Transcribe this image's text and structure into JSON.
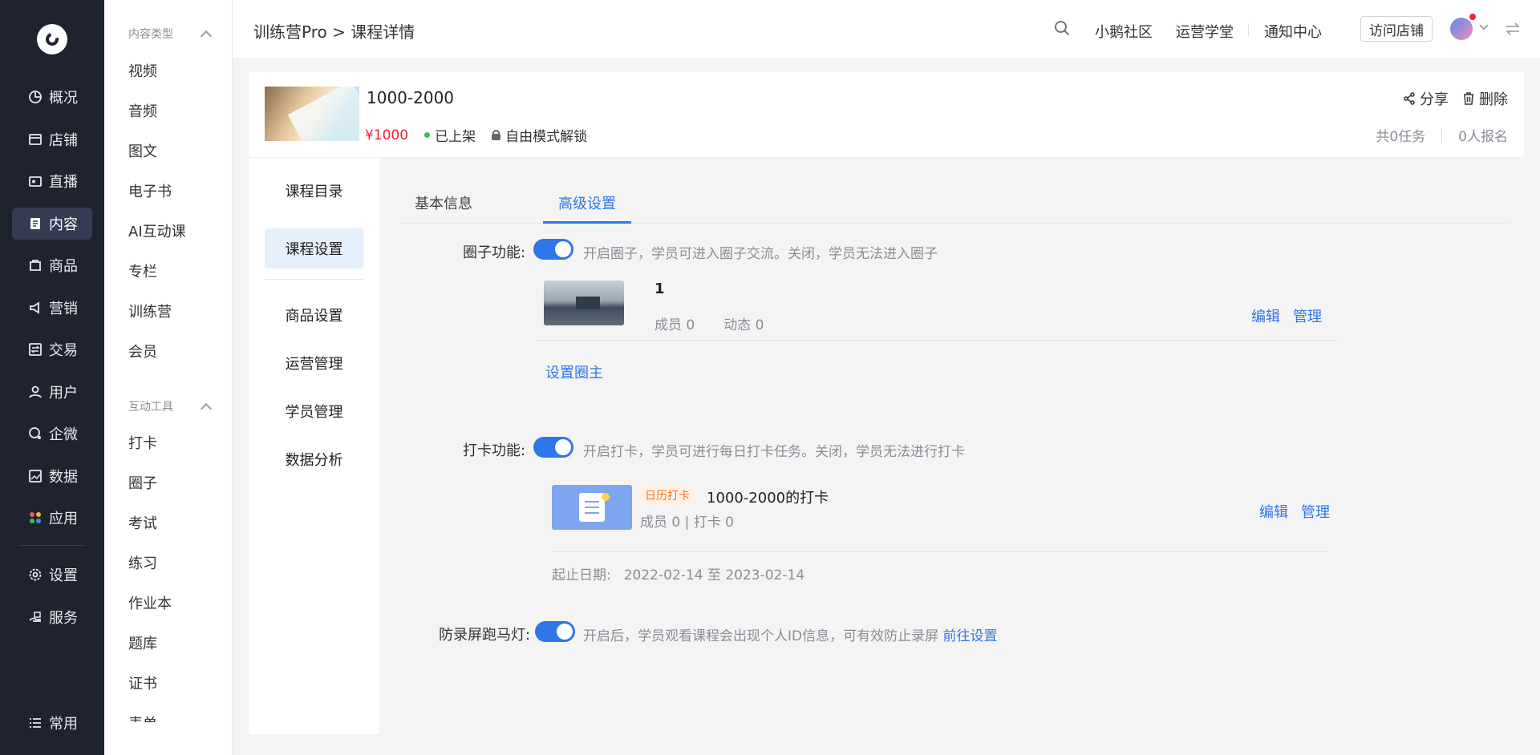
{
  "nav": {
    "items": [
      {
        "label": "概况",
        "icon": "pie-chart-icon"
      },
      {
        "label": "店铺",
        "icon": "store-icon"
      },
      {
        "label": "直播",
        "icon": "live-icon"
      },
      {
        "label": "内容",
        "icon": "content-icon"
      },
      {
        "label": "商品",
        "icon": "goods-icon"
      },
      {
        "label": "营销",
        "icon": "megaphone-icon"
      },
      {
        "label": "交易",
        "icon": "trade-icon"
      },
      {
        "label": "用户",
        "icon": "user-icon"
      },
      {
        "label": "企微",
        "icon": "wecom-icon"
      },
      {
        "label": "数据",
        "icon": "data-icon"
      },
      {
        "label": "应用",
        "icon": "apps-icon"
      },
      {
        "label": "设置",
        "icon": "gear-icon"
      },
      {
        "label": "服务",
        "icon": "service-icon"
      },
      {
        "label": "常用",
        "icon": "list-icon"
      }
    ],
    "active": "内容"
  },
  "side2": {
    "group1": "内容类型",
    "group1_items": [
      "视频",
      "音频",
      "图文",
      "电子书",
      "AI互动课",
      "专栏",
      "训练营",
      "会员"
    ],
    "group2": "互动工具",
    "group2_items": [
      "打卡",
      "圈子",
      "考试",
      "练习",
      "作业本",
      "题库",
      "证书",
      "表单"
    ]
  },
  "topbar": {
    "breadcrumb": "训练营Pro > 课程详情",
    "links": [
      "小鹅社区",
      "运营学堂",
      "通知中心"
    ],
    "visit_button": "访问店铺"
  },
  "course": {
    "title": "1000-2000",
    "price": "¥1000",
    "status": "已上架",
    "unlock_mode": "自由模式解锁",
    "share": "分享",
    "delete": "删除",
    "tasks": "共0任务",
    "signups": "0人报名"
  },
  "content_side": {
    "items": [
      "课程目录",
      "课程设置",
      "商品设置",
      "运营管理",
      "学员管理",
      "数据分析"
    ],
    "active": "课程设置"
  },
  "tabs": {
    "items": [
      "基本信息",
      "高级设置"
    ],
    "active": "高级设置"
  },
  "circle": {
    "label": "圈子功能:",
    "enabled": true,
    "desc": "开启圈子，学员可进入圈子交流。关闭，学员无法进入圈子",
    "item_title": "1",
    "members": "成员 0",
    "posts": "动态 0",
    "edit": "编辑",
    "manage": "管理",
    "set_owner": "设置圈主"
  },
  "checkin": {
    "label": "打卡功能:",
    "enabled": true,
    "desc": "开启打卡，学员可进行每日打卡任务。关闭，学员无法进行打卡",
    "tag": "日历打卡",
    "item_title": "1000-2000的打卡",
    "meta": "成员 0 | 打卡 0",
    "edit": "编辑",
    "manage": "管理",
    "date_label": "起止日期:",
    "date_range": "2022-02-14 至 2023-02-14"
  },
  "marquee": {
    "label": "防录屏跑马灯:",
    "enabled": true,
    "desc": "开启后，学员观看课程会出现个人ID信息，可有效防止录屏",
    "link": "前往设置"
  },
  "colors": {
    "nav_bg": "#1f2330",
    "accent": "#2f76e8",
    "price": "#f5222d",
    "tag": "#f5761d"
  }
}
